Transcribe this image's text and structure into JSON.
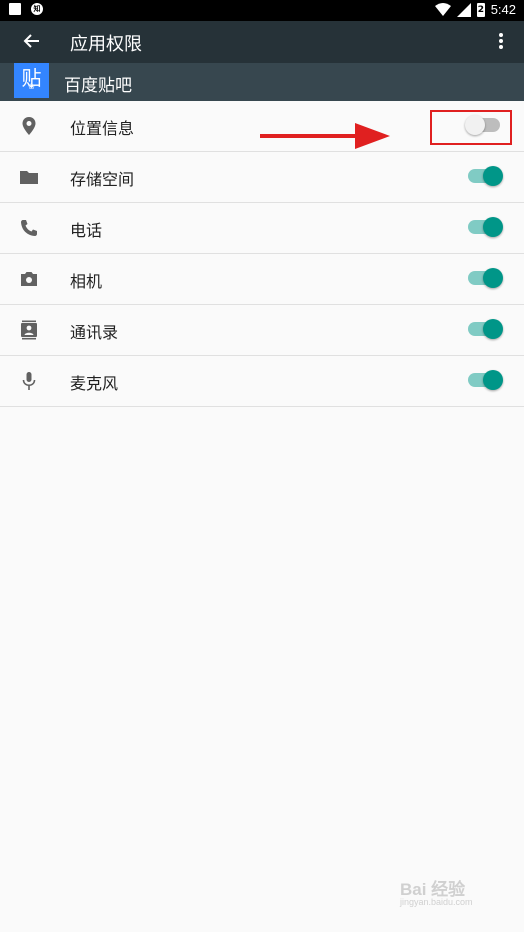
{
  "status_bar": {
    "time": "5:42",
    "notif_icon": "知",
    "battery_level_text": "2"
  },
  "toolbar": {
    "title": "应用权限"
  },
  "app": {
    "icon_text": "贴",
    "icon_sub": "❀",
    "name": "百度贴吧",
    "accent": "#3385ff"
  },
  "permissions": [
    {
      "label": "位置信息",
      "icon": "location-icon",
      "enabled": false
    },
    {
      "label": "存储空间",
      "icon": "folder-icon",
      "enabled": true
    },
    {
      "label": "电话",
      "icon": "phone-icon",
      "enabled": true
    },
    {
      "label": "相机",
      "icon": "camera-icon",
      "enabled": true
    },
    {
      "label": "通讯录",
      "icon": "contacts-icon",
      "enabled": true
    },
    {
      "label": "麦克风",
      "icon": "microphone-icon",
      "enabled": true
    }
  ],
  "watermark": {
    "brand": "Bai 经验",
    "url": "jingyan.baidu.com"
  },
  "colors": {
    "toolbar": "#263238",
    "app_header": "#37474f",
    "switch_on": "#009688",
    "annotation": "#e02020"
  }
}
